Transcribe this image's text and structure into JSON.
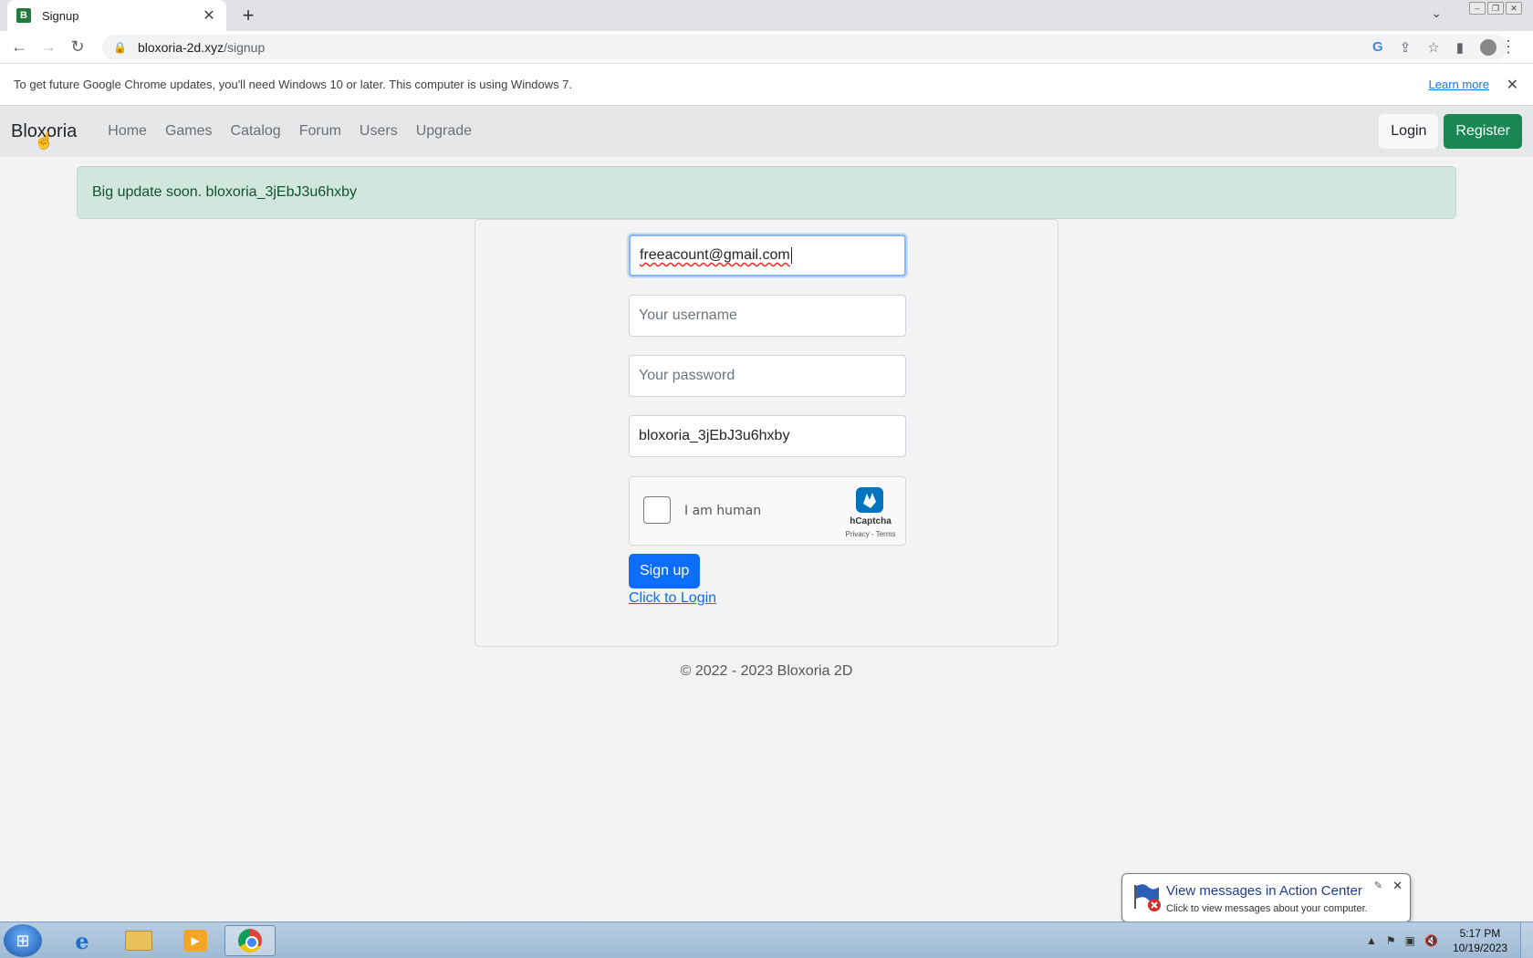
{
  "browser": {
    "tab_title": "Signup",
    "tab_favicon": "B",
    "url_domain": "bloxoria-2d.xyz",
    "url_path": "/signup"
  },
  "infobar": {
    "message": "To get future Google Chrome updates, you'll need Windows 10 or later. This computer is using Windows 7.",
    "learn_more": "Learn more"
  },
  "site": {
    "brand": "Bloxoria",
    "nav": [
      "Home",
      "Games",
      "Catalog",
      "Forum",
      "Users",
      "Upgrade"
    ],
    "login_label": "Login",
    "register_label": "Register",
    "alert": "Big update soon. bloxoria_3jEbJ3u6hxby"
  },
  "form": {
    "email_value": "freeacount@gmail.com",
    "username_placeholder": "Your username",
    "password_placeholder": "Your password",
    "invite_value": "bloxoria_3jEbJ3u6hxby",
    "captcha_label": "I am human",
    "captcha_brand": "hCaptcha",
    "captcha_terms": "Privacy - Terms",
    "signup_label": "Sign up",
    "login_link": "Click to Login"
  },
  "footer": "© 2022 - 2023 Bloxoria 2D",
  "notification": {
    "title": "View messages in Action Center",
    "subtitle": "Click to view messages about your computer."
  },
  "taskbar": {
    "time": "5:17 PM",
    "date": "10/19/2023"
  },
  "colors": {
    "register": "#198754",
    "signup": "#0d6efd",
    "alert_bg": "#d1e7dd"
  }
}
